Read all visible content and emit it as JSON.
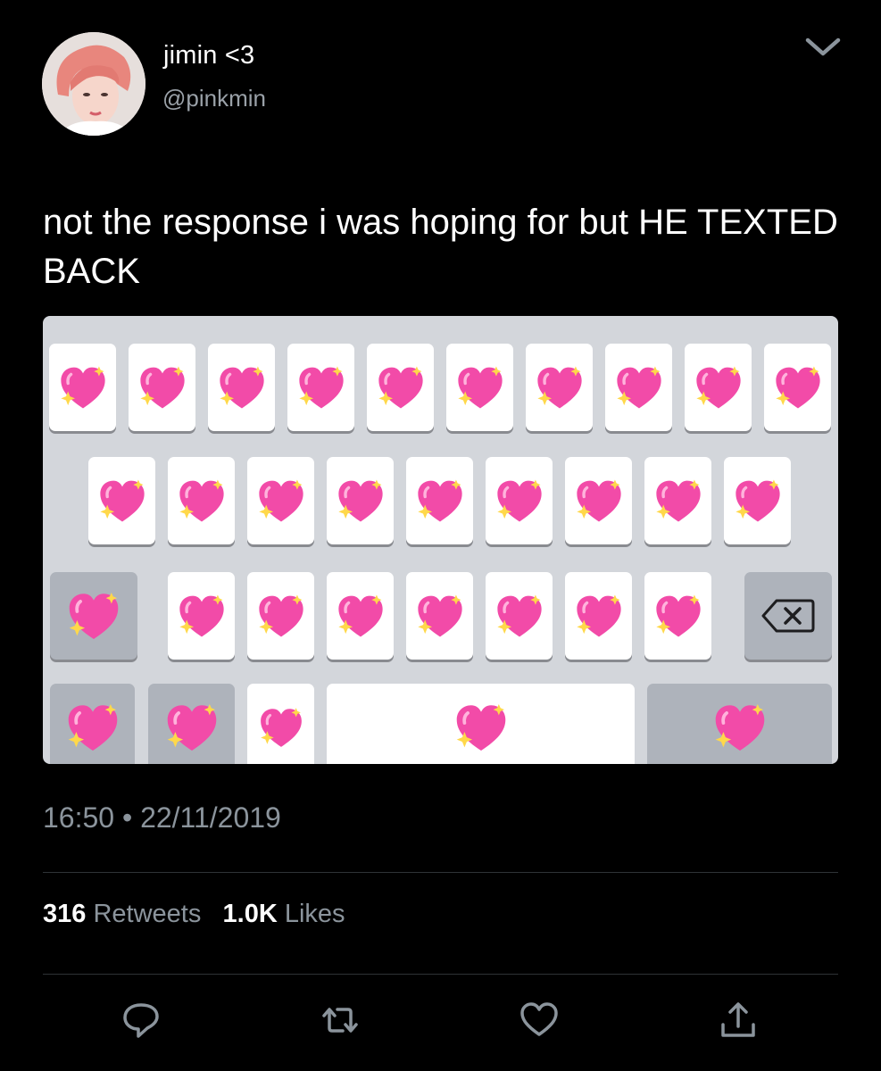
{
  "tweet": {
    "display_name": "jimin <3",
    "handle": "@pinkmin",
    "text": "not the response i was hoping for but HE TEXTED BACK",
    "time": "16:50",
    "separator": "•",
    "date": "22/11/2019",
    "retweets_count": "316",
    "retweets_label": "Retweets",
    "likes_count": "1.0K",
    "likes_label": "Likes"
  },
  "media": {
    "key_icon": "sparkling-heart-icon",
    "delete_key_icon": "backspace-icon",
    "rows": [
      {
        "keys": 10,
        "special": []
      },
      {
        "keys": 9,
        "special": []
      },
      {
        "keys": 7,
        "special": [
          "left-modifier",
          "backspace"
        ]
      },
      {
        "keys": 3,
        "special": [
          "left-modifiers",
          "space",
          "return"
        ]
      }
    ]
  },
  "icons": {
    "menu": "chevron-down-icon",
    "reply": "reply-icon",
    "retweet": "retweet-icon",
    "like": "heart-icon",
    "share": "share-icon"
  },
  "colors": {
    "background": "#000000",
    "secondary_text": "#8b949c",
    "divider": "#2f3336",
    "heart": "#f24ba8",
    "sparkle": "#ffd84a"
  }
}
